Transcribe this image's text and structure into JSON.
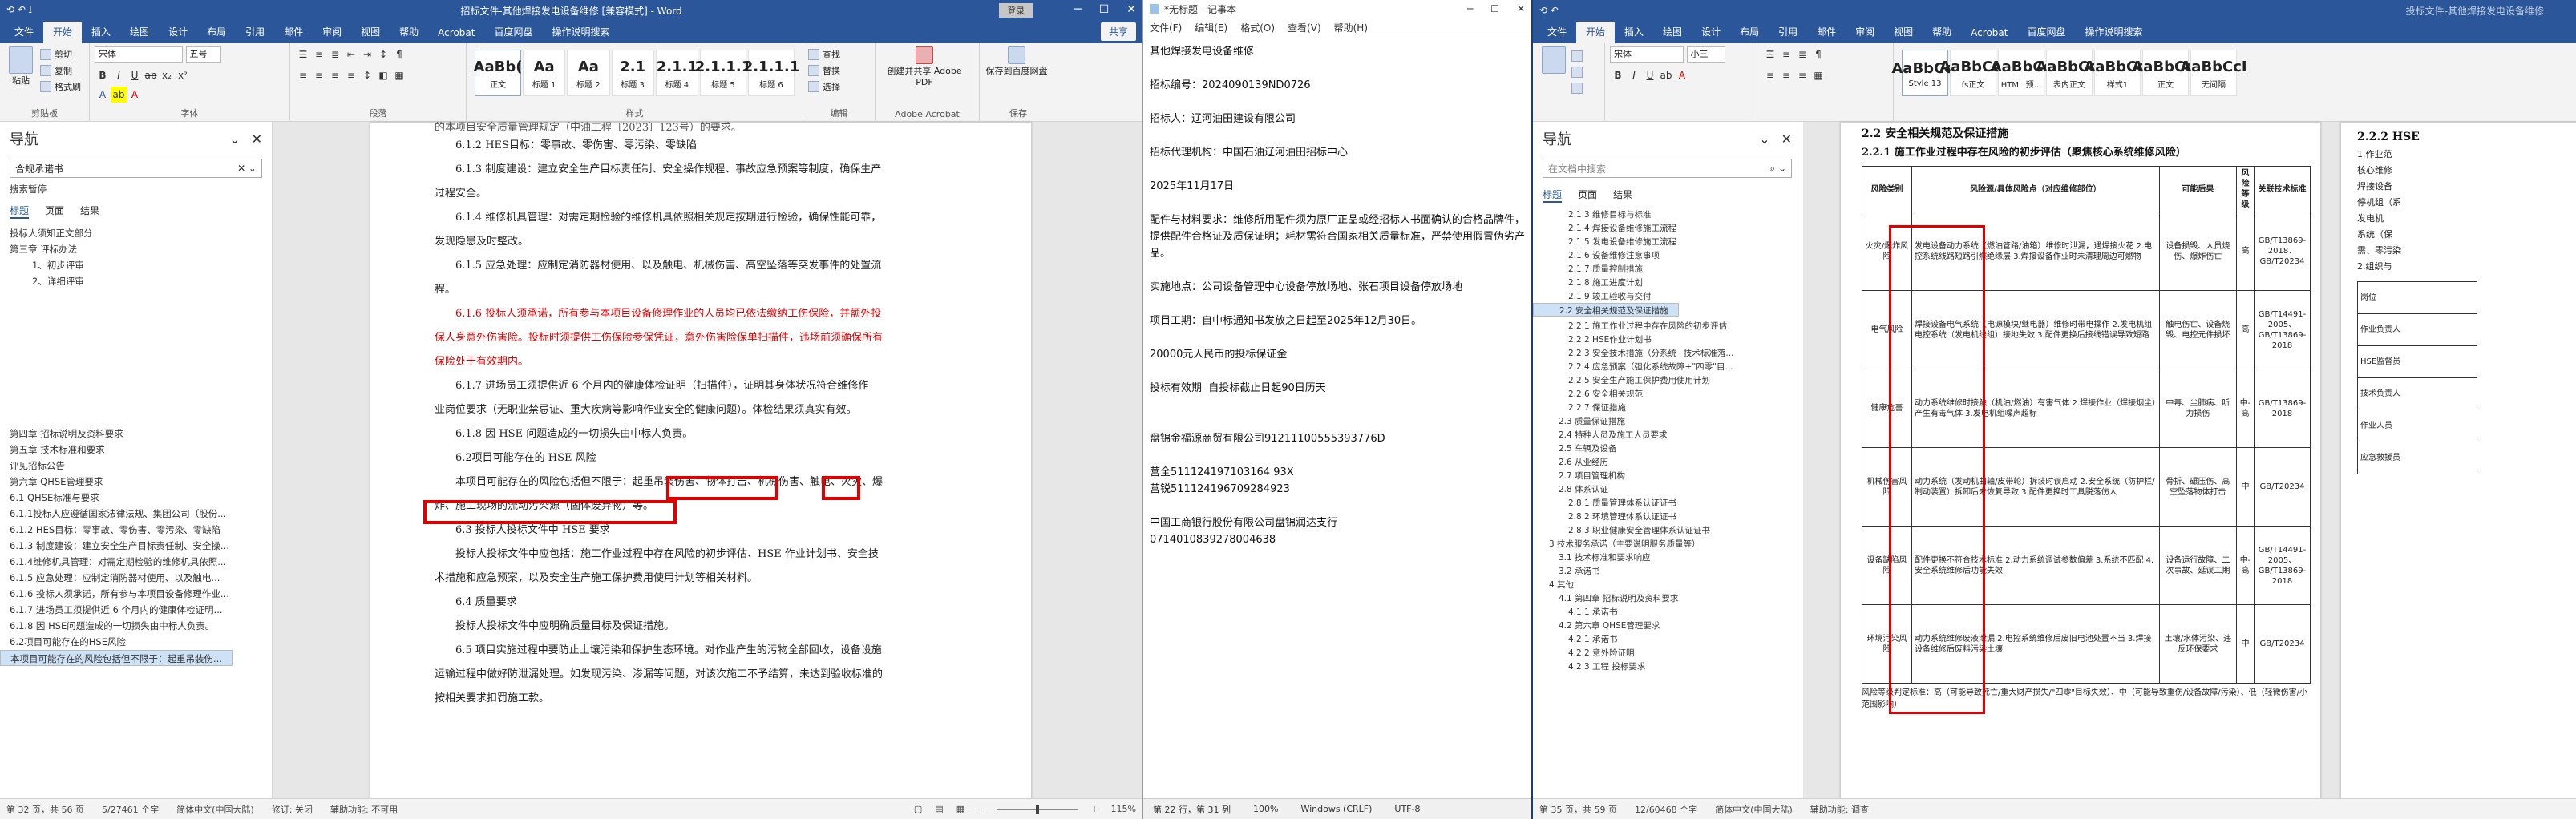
{
  "left_window": {
    "title": "招标文件-其他焊接发电设备维修 [兼容模式] - Word",
    "account": "登录",
    "share": "共享",
    "tabs": [
      "文件",
      "开始",
      "插入",
      "绘图",
      "设计",
      "布局",
      "引用",
      "邮件",
      "审阅",
      "视图",
      "帮助",
      "Acrobat",
      "百度网盘",
      "操作说明搜索"
    ],
    "ribbon": {
      "clipboard": {
        "paste": "粘贴",
        "cut": "剪切",
        "copy": "复制",
        "format": "格式刷",
        "label": "剪贴板"
      },
      "font": {
        "name": "宋体",
        "size": "五号",
        "label": "字体"
      },
      "paragraph_label": "段落",
      "styles": [
        {
          "sample": "AaBb(",
          "name": "正文"
        },
        {
          "sample": "Aa",
          "name": "标题 1"
        },
        {
          "sample": "Aa",
          "name": "标题 2"
        },
        {
          "sample": "2.1",
          "name": "标题 3"
        },
        {
          "sample": "2.1.1",
          "name": "标题 4"
        },
        {
          "sample": "2.1.1.1",
          "name": "标题 5"
        },
        {
          "sample": "2.1.1.1",
          "name": "标题 6"
        }
      ],
      "styles_label": "样式",
      "editing": {
        "find": "查找",
        "replace": "替换",
        "select": "选择",
        "label": "编辑"
      },
      "acrobat": {
        "label": "创建并共享 Adobe PDF",
        "group": "Adobe Acrobat"
      },
      "baidu": {
        "label": "保存到百度网盘",
        "group": "保存"
      }
    },
    "nav": {
      "title": "导航",
      "search_value": "合规承诺书",
      "result_label": "搜索暂停",
      "tabs": [
        "标题",
        "页面",
        "结果"
      ],
      "items": [
        "投标人须知正文部分",
        "第三章 评标办法",
        "1、初步评审",
        "2、详细评审",
        "第四章 招标说明及资料要求",
        "第五章 技术标准和要求",
        "评见招标公告",
        "第六章 QHSE管理要求",
        "6.1 QHSE标准与要求",
        "6.1.1投标人应遵循国家法律法规、集团公司（股份...",
        "6.1.2 HES目标：零事故、零伤害、零污染、零缺陷",
        "6.1.3 制度建设：建立安全生产目标责任制、安全操...",
        "6.1.4维修机具管理：对需定期检验的维修机具依照...",
        "6.1.5 应急处理：应制定消防器材使用、以及触电...",
        "6.1.6 投标人须承诺，所有参与本项目设备修理作业...",
        "6.1.7 进场员工须提供近 6 个月内的健康体检证明...",
        "6.1.8 因 HSE问题造成的一切损失由中标人负责。",
        "6.2项目可能存在的HSE风险",
        "本项目可能存在的风险包括但不限于：起重吊装伤..."
      ]
    },
    "doc": {
      "lines": [
        {
          "t": "6.1.2 HES目标：零事故、零伤害、零污染、零缺陷",
          "c": ""
        },
        {
          "t": "6.1.3 制度建设：建立安全生产目标责任制、安全操作规程、事故应急预案等制度，确保生产",
          "c": ""
        },
        {
          "t": "过程安全。",
          "c": ""
        },
        {
          "t": "6.1.4 维修机具管理：对需定期检验的维修机具依照相关规定按期进行检验，确保性能可靠，",
          "c": ""
        },
        {
          "t": "发现隐患及时整改。",
          "c": ""
        },
        {
          "t": "6.1.5 应急处理：应制定消防器材使用、以及触电、机械伤害、高空坠落等突发事件的处置流",
          "c": ""
        },
        {
          "t": "程。",
          "c": ""
        },
        {
          "t": "6.1.6 投标人须承诺，所有参与本项目设备修理作业的人员均已依法缴纳工伤保险，并额外投",
          "c": "red"
        },
        {
          "t": "保人身意外伤害险。投标时须提供工伤保险参保凭证，意外伤害险保单扫描件，违场前须确保所有",
          "c": "red"
        },
        {
          "t": "保险处于有效期内。",
          "c": "red"
        },
        {
          "t": "6.1.7 进场员工须提供近 6 个月内的健康体检证明（扫描件），证明其身体状况符合维修作",
          "c": ""
        },
        {
          "t": "业岗位要求（无职业禁忌证、重大疾病等影响作业安全的健康问题）。体检结果须真实有效。",
          "c": ""
        },
        {
          "t": "6.1.8 因 HSE 问题造成的一切损失由中标人负责。",
          "c": ""
        },
        {
          "t": "6.2项目可能存在的 HSE 风险",
          "c": ""
        },
        {
          "t": "本项目可能存在的风险包括但不限于：起重吊装伤害、物体打击、机械伤害、触电、火灾、爆",
          "c": ""
        },
        {
          "t": "炸、施工现场的流动污染源（固体废弃物）等。",
          "c": ""
        },
        {
          "t": "6.3 投标人投标文件中 HSE 要求",
          "c": ""
        },
        {
          "t": "投标人投标文件中应包括：施工作业过程中存在风险的初步评估、HSE 作业计划书、安全技",
          "c": ""
        },
        {
          "t": "术措施和应急预案，以及安全生产施工保护费用使用计划等相关材料。",
          "c": ""
        },
        {
          "t": "6.4 质量要求",
          "c": ""
        },
        {
          "t": "投标人投标文件中应明确质量目标及保证措施。",
          "c": ""
        },
        {
          "t": "6.5 项目实施过程中要防止土壤污染和保护生态环境。对作业产生的污物全部回收，设备设施",
          "c": ""
        },
        {
          "t": "运输过程中做好防泄漏处理。如发现污染、渗漏等问题，对该次施工不予结算，未达到验收标准的",
          "c": ""
        },
        {
          "t": "按相关要求扣罚施工款。",
          "c": ""
        }
      ],
      "top_partial": "的本项目安全质量管理规定（中油工程〔2023〕123号）的要求。"
    },
    "status": {
      "page": "第 32 页，共 56 页",
      "words": "5/27461 个字",
      "lang": "简体中文(中国大陆)",
      "revise": "修订: 关闭",
      "access": "辅助功能: 不可用",
      "zoom": "115%"
    }
  },
  "notepad": {
    "title": "*无标题 - 记事本",
    "menu": [
      "文件(F)",
      "编辑(E)",
      "格式(O)",
      "查看(V)",
      "帮助(H)"
    ],
    "lines": [
      "其他焊接发电设备维修",
      "",
      "招标编号：2024090139ND0726",
      "",
      "招标人：辽河油田建设有限公司",
      "",
      "招标代理机构：中国石油辽河油田招标中心",
      "",
      "2025年11月17日",
      "",
      "配件与材料要求：维修所用配件须为原厂正品或经招标人书面确认的合格品牌件，提供配件合格证及质保证明；耗材需符合国家相关质量标准，严禁使用假冒伪劣产品。",
      "",
      "实施地点：公司设备管理中心设备停放场地、张石项目设备停放场地",
      "",
      "项目工期：自中标通知书发放之日起至2025年12月30日。",
      "",
      "20000元人民币的投标保证金",
      "",
      "投标有效期  自投标截止日起90日历天",
      "",
      "",
      "盘锦金福源商贸有限公司91211100555393776D",
      "",
      "营全511124197103164 93X",
      "营锐511124196709284923",
      "",
      "中国工商银行股份有限公司盘锦润达支行",
      "0714010839278004638"
    ],
    "status": {
      "pos": "第 22 行，第 31 列",
      "zoom": "100%",
      "eol": "Windows (CRLF)",
      "enc": "UTF-8"
    }
  },
  "right_window": {
    "title": "投标文件-其他焊接发电设备维修",
    "tabs": [
      "文件",
      "开始",
      "插入",
      "绘图",
      "设计",
      "布局",
      "引用",
      "邮件",
      "审阅",
      "视图",
      "帮助",
      "Acrobat",
      "百度网盘",
      "操作说明搜索"
    ],
    "font": {
      "name": "宋体",
      "size": "小三"
    },
    "styles": [
      {
        "sample": "AaBbCcI",
        "name": "Style 13"
      },
      {
        "sample": "AaBbCcI",
        "name": "fs正文"
      },
      {
        "sample": "AaBbCc",
        "name": "HTML 预..."
      },
      {
        "sample": "AaBbCcI",
        "name": "表内正文"
      },
      {
        "sample": "AaBbCcI",
        "name": "样式1"
      },
      {
        "sample": "AaBbCcI",
        "name": "正文"
      },
      {
        "sample": "AaBbCcI",
        "name": "无间隔"
      }
    ],
    "nav": {
      "title": "导航",
      "search_placeholder": "在文档中搜索",
      "tabs": [
        "标题",
        "页面",
        "结果"
      ],
      "items": [
        "2.1.3 维修目标与标准",
        "2.1.4 焊接设备维修施工流程",
        "2.1.5 发电设备维修施工流程",
        "2.1.6 设备维修注意事项",
        "2.1.7 质量控制措施",
        "2.1.8 施工进度计划",
        "2.1.9 竣工验收与交付",
        "2.2 安全相关规范及保证措施",
        "2.2.1 施工作业过程中存在风险的初步评估",
        "2.2.2 HSE作业计划书",
        "2.2.3 安全技术措施（分系统+技术标准落...",
        "2.2.4 应急预案（强化系统故障+\"四零\"目...",
        "2.2.5 安全生产施工保护费用使用计划",
        "2.2.6 安全相关规范",
        "2.2.7 保证措施",
        "2.3 质量保证措施",
        "2.4 特种人员及施工人员要求",
        "2.5 车辆及设备",
        "2.6 从业经历",
        "2.7 项目管理机构",
        "2.8 体系认证",
        "2.8.1 质量管理体系认证证书",
        "2.8.2 环境管理体系认证证书",
        "2.8.3 职业健康安全管理体系认证证书",
        "3 技术服务承诺（主要说明服务质量等）",
        "3.1 技术标准和要求响应",
        "3.2 承诺书",
        "4 其他",
        "4.1 第四章 招标说明及资料要求",
        "4.1.1 承诺书",
        "4.2 第六章 QHSE管理要求",
        "4.2.1 承诺书",
        "4.2.2 意外险证明",
        "4.2.3 工程 投标要求"
      ]
    },
    "doc": {
      "h1": "2.2 安全相关规范及保证措施",
      "h2": "2.2.1 施工作业过程中存在风险的初步评估（聚焦核心系统维修风险）",
      "headers": [
        "风险类别",
        "风险源/具体风险点（对应维修部位）",
        "可能后果",
        "风险等级",
        "关联技术标准"
      ],
      "rows": [
        [
          "火灾/爆炸风险",
          "发电设备动力系统（燃油管路/油箱）维修时泄漏，遇焊接火花 2.电控系统线路短路引燃绝缘层 3.焊接设备作业时未清理周边可燃物",
          "设备损毁、人员烧伤、爆炸伤亡",
          "高",
          "GB/T13869-2018、GB/T20234"
        ],
        [
          "电气风险",
          "焊接设备电气系统（电源模块/继电器）维修时带电操作 2.发电机组电控系统（发电机线组）接地失效 3.配件更换后接线错误导致短路",
          "触电伤亡、设备烧毁、电控元件损坏",
          "高",
          "GB/T14491-2005、GB/T13869-2018"
        ],
        [
          "健康危害",
          "动力系统维修时接触（机油/燃油）有害气体 2.焊接作业（焊接烟尘）产生有毒气体 3.发电机组噪声超标",
          "中毒、尘肺病、听力损伤",
          "中-高",
          "GB/T13869-2018"
        ],
        [
          "机械伤害风险",
          "动力系统（发动机曲轴/皮带轮）拆装时误启动 2.安全系统（防护栏/制动装置）拆卸后未恢复导致 3.配件更换时工具脱落伤人",
          "骨折、碾压伤、高空坠落物体打击",
          "中",
          "GB/T20234"
        ],
        [
          "设备缺陷风险",
          "配件更换不符合技术标准 2.动力系统调试参数偏差 3.系统不匹配 4.安全系统维修后功能失效",
          "设备运行故障、二次事故、延误工期",
          "中-高",
          "GB/T14491-2005、GB/T13869-2018"
        ],
        [
          "环境污染风险",
          "动力系统维修废液泄漏 2.电控系统维修后废旧电池处置不当 3.焊接设备维修后废料污染土壤",
          "土壤/水体污染、违反环保要求",
          "中",
          "GB/T20234"
        ]
      ],
      "footnote": "风险等级判定标准：高（可能导致死亡/重大财产损失/\"四零\"目标失效）、中（可能导致重伤/设备故障/污染）、低（轻微伤害/小范围影响）",
      "side_h": "2.2.2 HSE",
      "side_lines": [
        "1.作业范",
        "核心维修",
        "焊接设备",
        "停机组（系",
        "发电机",
        "系统（保",
        "需、零污染",
        "2.组织与"
      ],
      "side_table": [
        "岗位",
        "作业负责人",
        "HSE监督员",
        "技术负责人",
        "作业人员",
        "应急救援员"
      ]
    },
    "status": {
      "page": "第 35 页，共 59 页",
      "words": "12/60468 个字",
      "lang": "简体中文(中国大陆)",
      "access": "辅助功能: 调查"
    }
  }
}
